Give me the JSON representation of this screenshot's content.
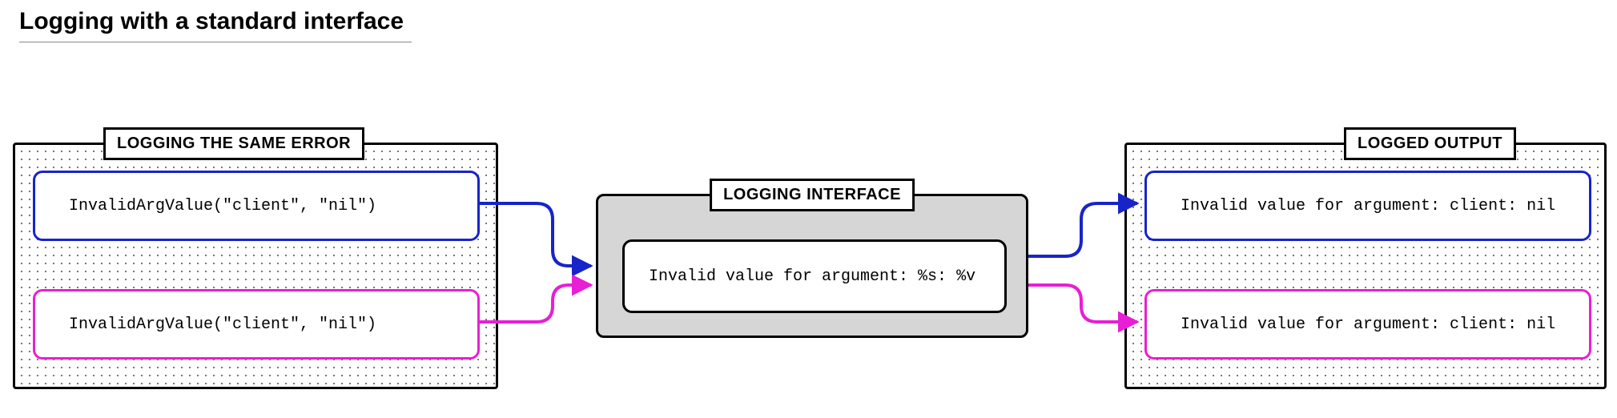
{
  "title": "Logging with a standard interface",
  "panels": {
    "left_label": "LOGGING THE SAME ERROR",
    "mid_label": "LOGGING INTERFACE",
    "right_label": "LOGGED OUTPUT"
  },
  "inputs": {
    "call1": "InvalidArgValue(\"client\", \"nil\")",
    "call2": "InvalidArgValue(\"client\", \"nil\")"
  },
  "interface_template": "Invalid value for argument: %s: %v",
  "outputs": {
    "out1": "Invalid value for argument: client: nil",
    "out2": "Invalid value for argument: client: nil"
  },
  "colors": {
    "blue": "#1724c9",
    "pink": "#e81fd4"
  }
}
